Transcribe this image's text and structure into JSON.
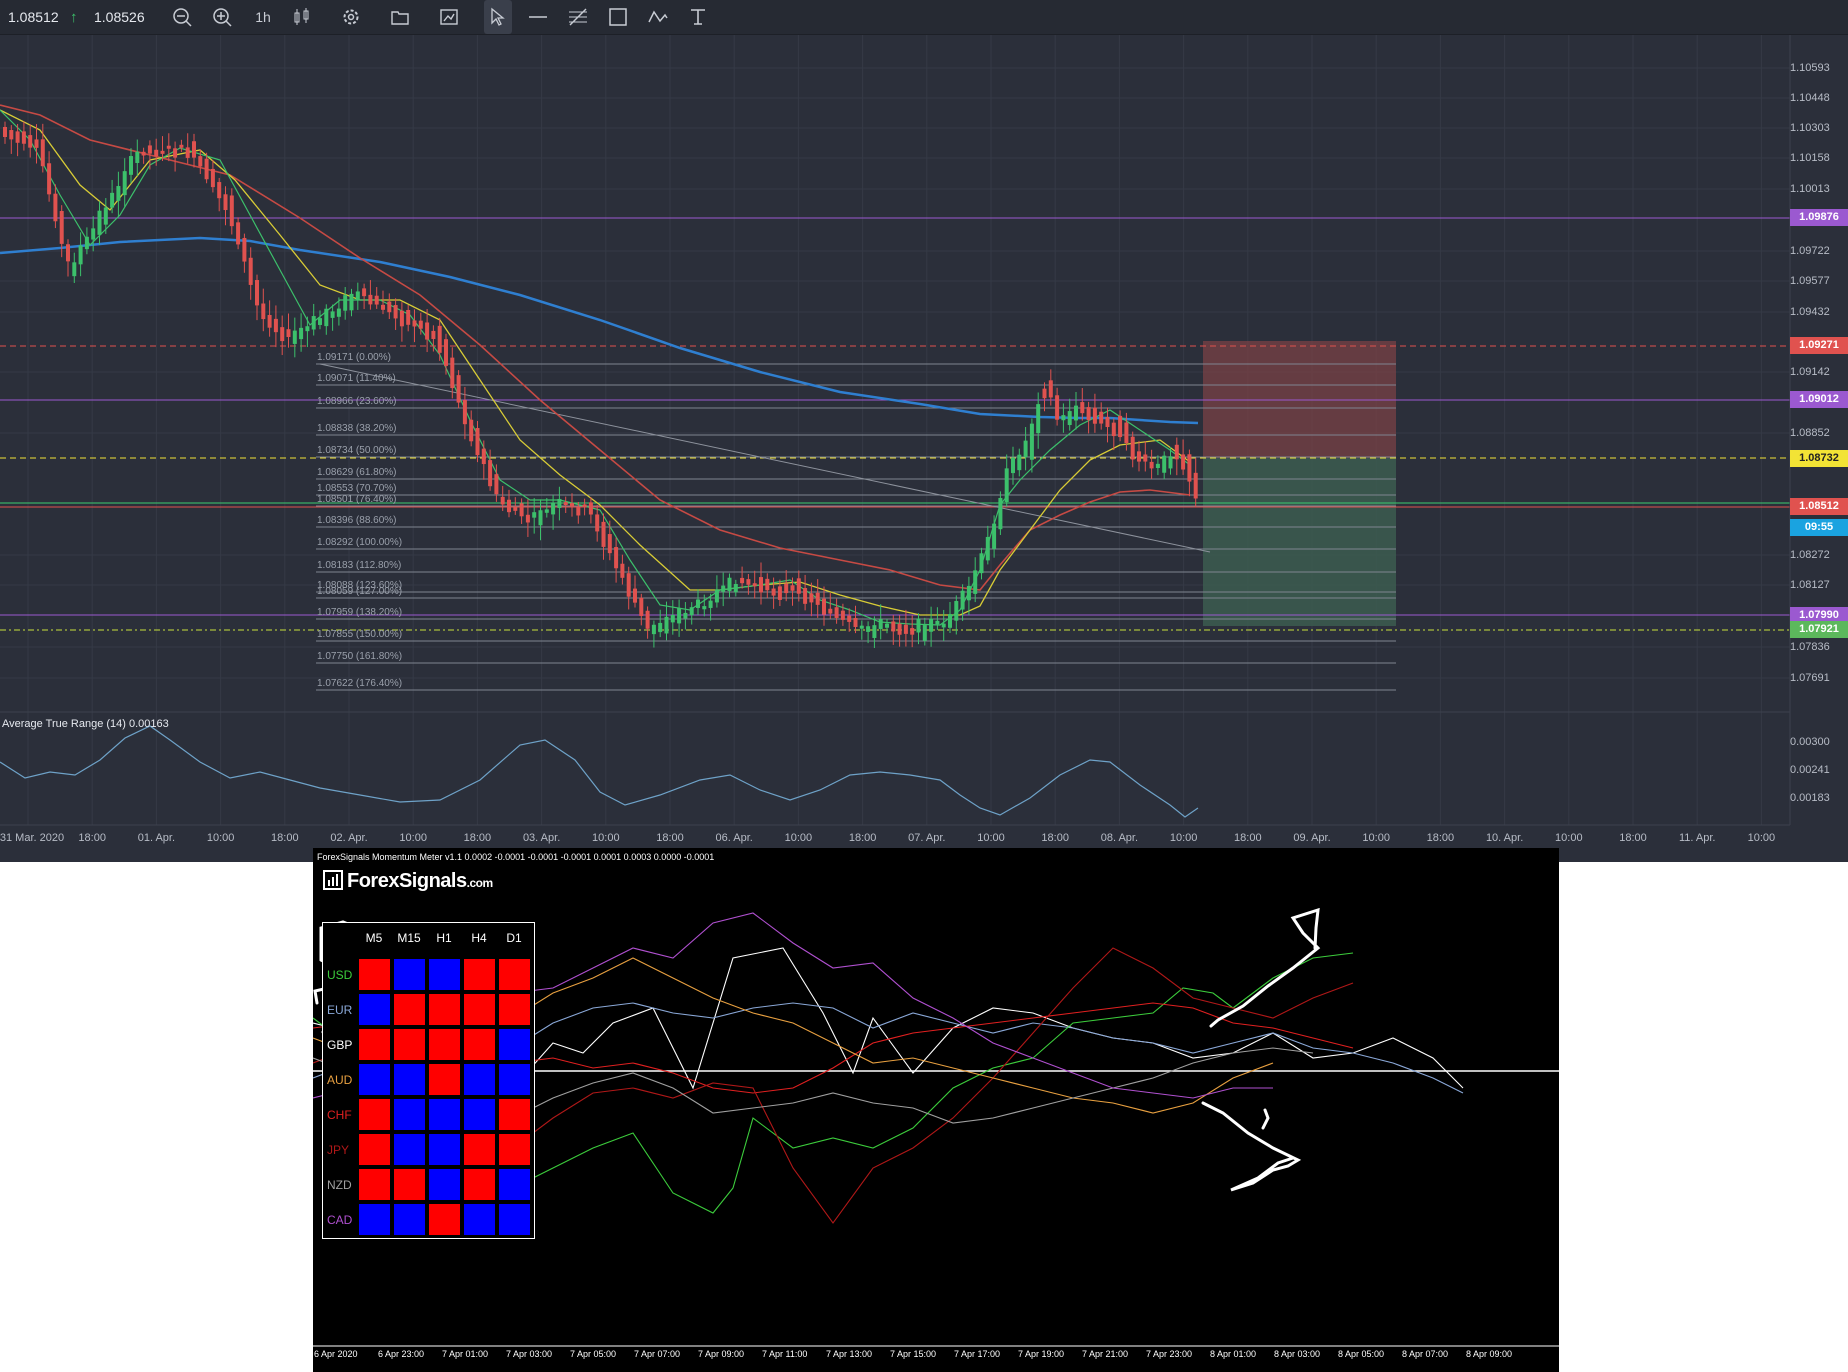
{
  "toolbar": {
    "bid": "1.08512",
    "ask": "1.08526",
    "timeframe": "1h",
    "icons": [
      "zoom-out-icon",
      "zoom-in-icon",
      "candles-icon",
      "gear-icon",
      "folder-icon",
      "screenshot-icon",
      "cursor-icon",
      "horizontal-line-icon",
      "fibonacci-icon",
      "rectangle-icon",
      "path-icon",
      "text-icon"
    ]
  },
  "price_axis": [
    "1.10593",
    "1.10448",
    "1.10303",
    "1.10158",
    "1.10013",
    "1.09722",
    "1.09577",
    "1.09432",
    "1.09142",
    "1.08852",
    "1.08272",
    "1.08127",
    "1.07836",
    "1.07691"
  ],
  "price_tags": [
    {
      "label": "1.09876",
      "bg": "#9b59d0",
      "fg": "#ffffff"
    },
    {
      "label": "1.09271",
      "bg": "#e0524f",
      "fg": "#ffffff"
    },
    {
      "label": "1.09012",
      "bg": "#9b59d0",
      "fg": "#ffffff"
    },
    {
      "label": "1.08732",
      "bg": "#f2e335",
      "fg": "#222222"
    },
    {
      "label": "1.08512",
      "bg": "#e0524f",
      "fg": "#ffffff"
    },
    {
      "label": "09:55",
      "bg": "#1aa3e0",
      "fg": "#ffffff"
    },
    {
      "label": "1.07990",
      "bg": "#9b59d0",
      "fg": "#ffffff"
    },
    {
      "label": "1.07921",
      "bg": "#5cb85c",
      "fg": "#ffffff"
    }
  ],
  "fib_levels": [
    "1.09171 (0.00%)",
    "1.09071 (11.40%)",
    "1.08966 (23.60%)",
    "1.08838 (38.20%)",
    "1.08734 (50.00%)",
    "1.08629 (61.80%)",
    "1.08553 (70.70%)",
    "1.08501 (76.40%)",
    "1.08396 (88.60%)",
    "1.08292 (100.00%)",
    "1.08183 (112.80%)",
    "1.08088 (123.60%)",
    "1.08059 (127.00%)",
    "1.07959 (138.20%)",
    "1.07855 (150.00%)",
    "1.07750 (161.80%)",
    "1.07622 (176.40%)"
  ],
  "atr": {
    "title": "Average True Range (14) 0.00163",
    "axis": [
      "0.00300",
      "0.00241",
      "0.00183"
    ]
  },
  "time_axis": [
    "31 Mar. 2020",
    "18:00",
    "01. Apr.",
    "10:00",
    "18:00",
    "02. Apr.",
    "10:00",
    "18:00",
    "03. Apr.",
    "10:00",
    "18:00",
    "06. Apr.",
    "10:00",
    "18:00",
    "07. Apr.",
    "10:00",
    "18:00",
    "08. Apr.",
    "10:00",
    "18:00",
    "09. Apr.",
    "10:00",
    "18:00",
    "10. Apr.",
    "10:00",
    "18:00",
    "11. Apr.",
    "10:00"
  ],
  "momentum": {
    "title": "ForexSignals Momentum Meter v1.1 0.0002 -0.0001 -0.0001 -0.0001 0.0001 0.0003 0.0000 -0.0001",
    "logo_main": "ForexSignals",
    "logo_suffix": ".com",
    "timeframes": [
      "M5",
      "M15",
      "H1",
      "H4",
      "D1"
    ],
    "currencies": [
      {
        "name": "USD",
        "color": "#3ccc3c",
        "cells": [
          "red",
          "blue",
          "blue",
          "red",
          "red"
        ]
      },
      {
        "name": "EUR",
        "color": "#8aa8d8",
        "cells": [
          "blue",
          "red",
          "red",
          "red",
          "red"
        ]
      },
      {
        "name": "GBP",
        "color": "#ffffff",
        "cells": [
          "red",
          "red",
          "red",
          "red",
          "blue"
        ]
      },
      {
        "name": "AUD",
        "color": "#e8a040",
        "cells": [
          "blue",
          "blue",
          "red",
          "blue",
          "blue"
        ]
      },
      {
        "name": "CHF",
        "color": "#e02020",
        "cells": [
          "red",
          "blue",
          "blue",
          "blue",
          "red"
        ]
      },
      {
        "name": "JPY",
        "color": "#b01818",
        "cells": [
          "red",
          "blue",
          "blue",
          "red",
          "red"
        ]
      },
      {
        "name": "NZD",
        "color": "#a0a0a0",
        "cells": [
          "red",
          "red",
          "blue",
          "red",
          "blue"
        ]
      },
      {
        "name": "CAD",
        "color": "#b050d0",
        "cells": [
          "blue",
          "blue",
          "red",
          "blue",
          "blue"
        ]
      }
    ],
    "time_axis": [
      "6 Apr 2020",
      "6 Apr 23:00",
      "7 Apr 01:00",
      "7 Apr 03:00",
      "7 Apr 05:00",
      "7 Apr 07:00",
      "7 Apr 09:00",
      "7 Apr 11:00",
      "7 Apr 13:00",
      "7 Apr 15:00",
      "7 Apr 17:00",
      "7 Apr 19:00",
      "7 Apr 21:00",
      "7 Apr 23:00",
      "8 Apr 01:00",
      "8 Apr 03:00",
      "8 Apr 05:00",
      "8 Apr 07:00",
      "8 Apr 09:00"
    ]
  }
}
